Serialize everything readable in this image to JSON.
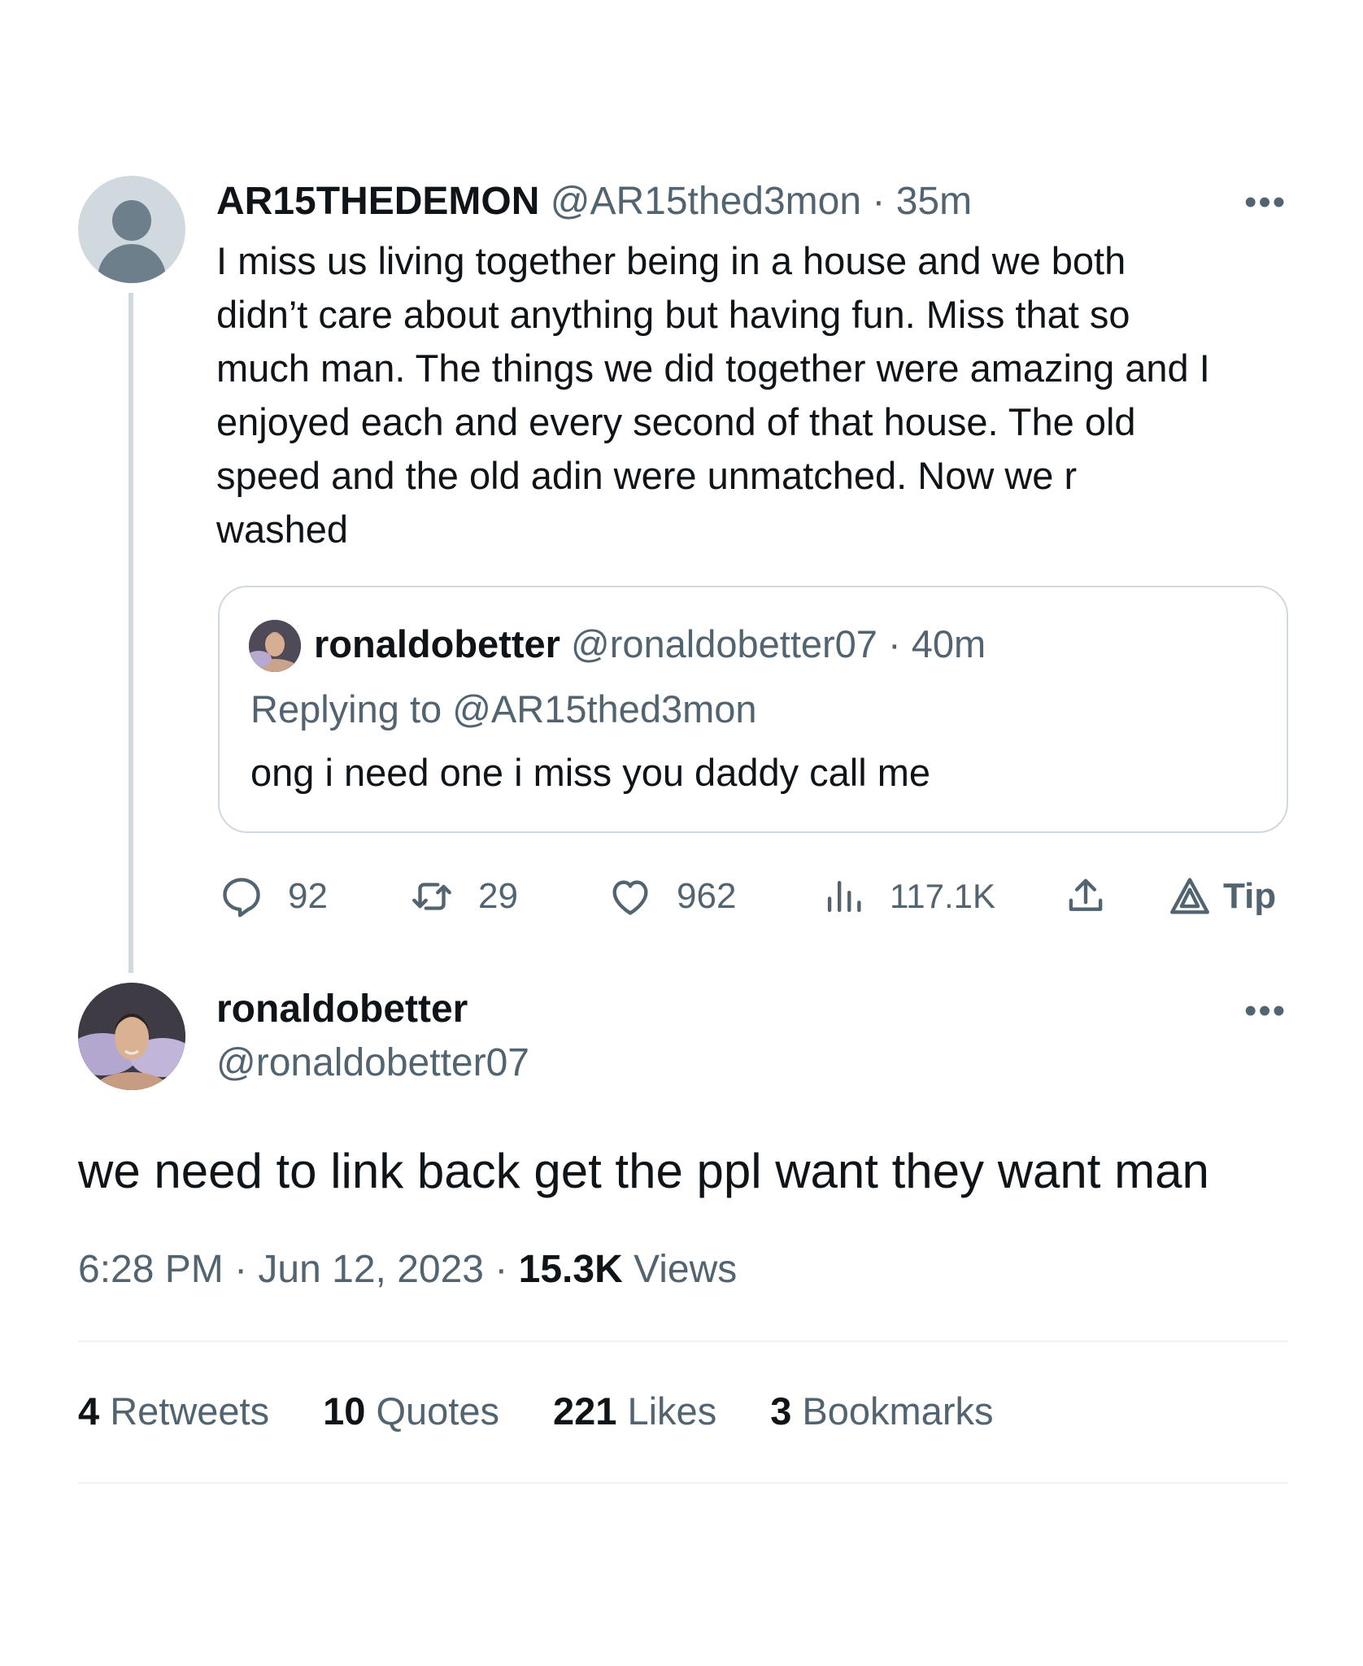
{
  "parent_tweet": {
    "display_name": "AR15THEDEMON",
    "handle": "@AR15thed3mon",
    "separator": " · ",
    "time": "35m",
    "text": "I miss us living together being in a house and we both\ndidn’t care about anything but having fun.  Miss that so\nmuch man. The things we did together were amazing and I\nenjoyed each and every second of that house. The old\nspeed and the old adin were unmatched. Now we r\nwashed",
    "quoted": {
      "display_name": "ronaldobetter",
      "handle": "@ronaldobetter07",
      "separator": " · ",
      "time": "40m",
      "replying_to": "Replying to @AR15thed3mon",
      "text": "ong i need one i miss you daddy call me"
    },
    "actions": {
      "replies": "92",
      "retweets": "29",
      "likes": "962",
      "views": "117.1K",
      "tip_label": "Tip"
    },
    "icons": [
      "avatar-placeholder-icon",
      "more-icon",
      "reply-icon",
      "retweet-icon",
      "like-icon",
      "views-icon",
      "share-icon",
      "tip-icon"
    ]
  },
  "main_tweet": {
    "display_name": "ronaldobetter",
    "handle": "@ronaldobetter07",
    "text": "we need to link back get the ppl want they want man",
    "time": "6:28 PM",
    "sep1": " · ",
    "date": "Jun 12, 2023",
    "sep2": " · ",
    "views_count": "15.3K",
    "views_label": " Views",
    "stats": {
      "retweets_count": "4",
      "retweets_label": " Retweets",
      "quotes_count": "10",
      "quotes_label": " Quotes",
      "likes_count": "221",
      "likes_label": " Likes",
      "bookmarks_count": "3",
      "bookmarks_label": " Bookmarks"
    }
  },
  "colors": {
    "text_primary": "#0f1419",
    "text_secondary": "#536471",
    "border": "#cfd9de",
    "divider": "#eff3f4",
    "background": "#ffffff"
  }
}
